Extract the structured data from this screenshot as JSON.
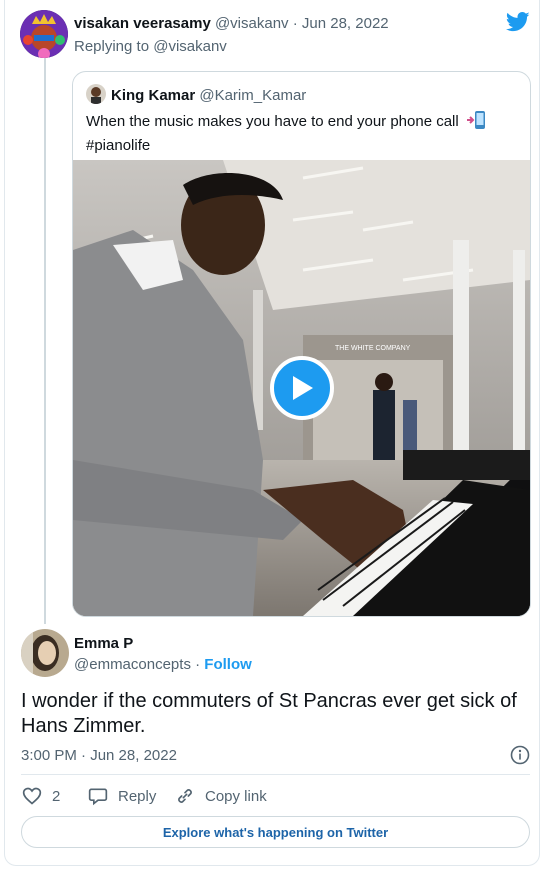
{
  "tweet_reply": {
    "author_name": "visakan veerasamy",
    "author_handle": "@visakanv",
    "date": "· Jun 28, 2022",
    "replying_to_prefix": "Replying to",
    "replying_to_handle": "@visakanv"
  },
  "quoted_tweet": {
    "author_name": "King Kamar",
    "author_handle": "@Karim_Kamar",
    "text": "When the music makes you have to end your phone call",
    "hashtag": "#pianolife",
    "media_sign_text": "THE WHITE COMPANY"
  },
  "main_tweet": {
    "author_name": "Emma P",
    "author_handle": "@emmaconcepts",
    "separator": "·",
    "follow_label": "Follow",
    "text": "I wonder if the commuters of St Pancras ever get sick of Hans Zimmer.",
    "timestamp": "3:00 PM · Jun 28, 2022"
  },
  "actions": {
    "like_count": "2",
    "reply_label": "Reply",
    "copy_link_label": "Copy link"
  },
  "explore_label": "Explore what's happening on Twitter",
  "icons": {
    "brand": "twitter-bird-icon",
    "play": "play-icon",
    "info": "info-icon",
    "like": "heart-icon",
    "reply": "reply-bubble-icon",
    "copy": "link-icon",
    "phone": "phone-exit-emoji-icon"
  },
  "colors": {
    "accent": "#1d9bf0",
    "text": "#0f1419",
    "muted": "#536471",
    "border": "#cfd9de"
  }
}
